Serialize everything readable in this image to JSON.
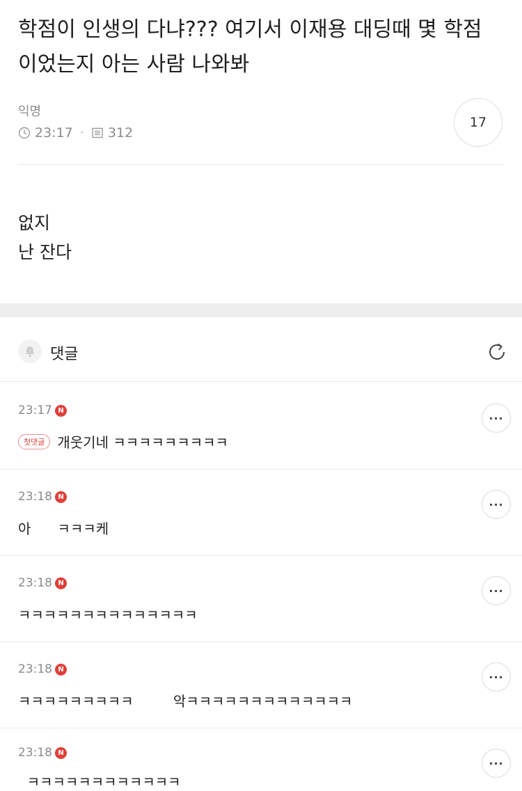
{
  "post": {
    "title": "학점이 인생의 다냐??? 여기서 이재용 대딩때 몇 학점이었는지 아는 사람 나와봐",
    "author": "익명",
    "time": "23:17",
    "views": "312",
    "comment_count": "17",
    "body_lines": [
      "없지",
      "난 잔다"
    ]
  },
  "comments_section": {
    "label": "댓글",
    "icons": {
      "bell": "bell-icon",
      "refresh": "refresh-icon",
      "more": "more-icon"
    },
    "new_badge": "N",
    "more_label": "···",
    "items": [
      {
        "time": "23:17",
        "first_badge": "첫댓글",
        "text": "개웃기네 ㅋㅋㅋㅋㅋㅋㅋㅋㅋ"
      },
      {
        "time": "23:18",
        "text": "아      ㅋㅋㅋ케"
      },
      {
        "time": "23:18",
        "text": "ㅋㅋㅋㅋㅋㅋㅋㅋㅋㅋㅋㅋㅋㅋ"
      },
      {
        "time": "23:18",
        "text": "ㅋㅋㅋㅋㅋㅋㅋㅋㅋ         악ㅋㅋㅋㅋㅋㅋㅋㅋㅋㅋㅋㅋㅋ"
      },
      {
        "time": "23:18",
        "text": "  ㅋㅋㅋㅋㅋㅋㅋㅋㅋㅋㅋㅋ"
      }
    ]
  },
  "colors": {
    "badge_red": "#e0403a",
    "divider": "#e8e8e8",
    "section_gap": "#eeeeef",
    "meta_gray": "#8c8c8c"
  }
}
